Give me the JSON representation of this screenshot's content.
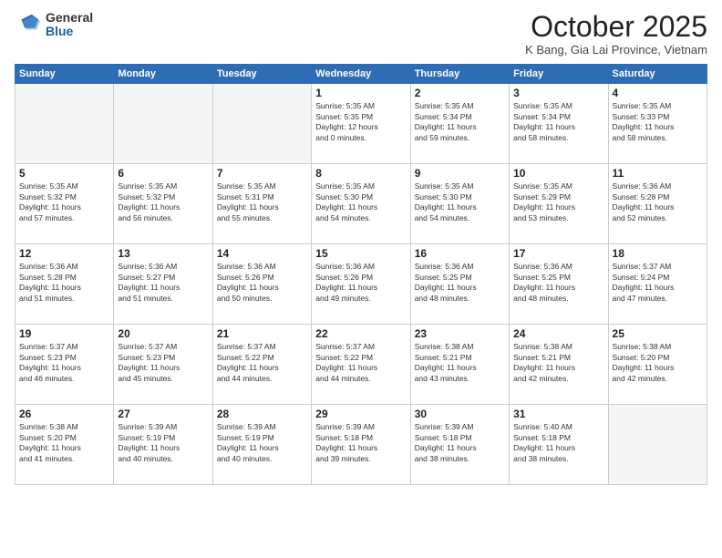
{
  "logo": {
    "general": "General",
    "blue": "Blue"
  },
  "header": {
    "month": "October 2025",
    "location": "K Bang, Gia Lai Province, Vietnam"
  },
  "weekdays": [
    "Sunday",
    "Monday",
    "Tuesday",
    "Wednesday",
    "Thursday",
    "Friday",
    "Saturday"
  ],
  "weeks": [
    [
      {
        "day": "",
        "info": ""
      },
      {
        "day": "",
        "info": ""
      },
      {
        "day": "",
        "info": ""
      },
      {
        "day": "1",
        "info": "Sunrise: 5:35 AM\nSunset: 5:35 PM\nDaylight: 12 hours\nand 0 minutes."
      },
      {
        "day": "2",
        "info": "Sunrise: 5:35 AM\nSunset: 5:34 PM\nDaylight: 11 hours\nand 59 minutes."
      },
      {
        "day": "3",
        "info": "Sunrise: 5:35 AM\nSunset: 5:34 PM\nDaylight: 11 hours\nand 58 minutes."
      },
      {
        "day": "4",
        "info": "Sunrise: 5:35 AM\nSunset: 5:33 PM\nDaylight: 11 hours\nand 58 minutes."
      }
    ],
    [
      {
        "day": "5",
        "info": "Sunrise: 5:35 AM\nSunset: 5:32 PM\nDaylight: 11 hours\nand 57 minutes."
      },
      {
        "day": "6",
        "info": "Sunrise: 5:35 AM\nSunset: 5:32 PM\nDaylight: 11 hours\nand 56 minutes."
      },
      {
        "day": "7",
        "info": "Sunrise: 5:35 AM\nSunset: 5:31 PM\nDaylight: 11 hours\nand 55 minutes."
      },
      {
        "day": "8",
        "info": "Sunrise: 5:35 AM\nSunset: 5:30 PM\nDaylight: 11 hours\nand 54 minutes."
      },
      {
        "day": "9",
        "info": "Sunrise: 5:35 AM\nSunset: 5:30 PM\nDaylight: 11 hours\nand 54 minutes."
      },
      {
        "day": "10",
        "info": "Sunrise: 5:35 AM\nSunset: 5:29 PM\nDaylight: 11 hours\nand 53 minutes."
      },
      {
        "day": "11",
        "info": "Sunrise: 5:36 AM\nSunset: 5:28 PM\nDaylight: 11 hours\nand 52 minutes."
      }
    ],
    [
      {
        "day": "12",
        "info": "Sunrise: 5:36 AM\nSunset: 5:28 PM\nDaylight: 11 hours\nand 51 minutes."
      },
      {
        "day": "13",
        "info": "Sunrise: 5:36 AM\nSunset: 5:27 PM\nDaylight: 11 hours\nand 51 minutes."
      },
      {
        "day": "14",
        "info": "Sunrise: 5:36 AM\nSunset: 5:26 PM\nDaylight: 11 hours\nand 50 minutes."
      },
      {
        "day": "15",
        "info": "Sunrise: 5:36 AM\nSunset: 5:26 PM\nDaylight: 11 hours\nand 49 minutes."
      },
      {
        "day": "16",
        "info": "Sunrise: 5:36 AM\nSunset: 5:25 PM\nDaylight: 11 hours\nand 48 minutes."
      },
      {
        "day": "17",
        "info": "Sunrise: 5:36 AM\nSunset: 5:25 PM\nDaylight: 11 hours\nand 48 minutes."
      },
      {
        "day": "18",
        "info": "Sunrise: 5:37 AM\nSunset: 5:24 PM\nDaylight: 11 hours\nand 47 minutes."
      }
    ],
    [
      {
        "day": "19",
        "info": "Sunrise: 5:37 AM\nSunset: 5:23 PM\nDaylight: 11 hours\nand 46 minutes."
      },
      {
        "day": "20",
        "info": "Sunrise: 5:37 AM\nSunset: 5:23 PM\nDaylight: 11 hours\nand 45 minutes."
      },
      {
        "day": "21",
        "info": "Sunrise: 5:37 AM\nSunset: 5:22 PM\nDaylight: 11 hours\nand 44 minutes."
      },
      {
        "day": "22",
        "info": "Sunrise: 5:37 AM\nSunset: 5:22 PM\nDaylight: 11 hours\nand 44 minutes."
      },
      {
        "day": "23",
        "info": "Sunrise: 5:38 AM\nSunset: 5:21 PM\nDaylight: 11 hours\nand 43 minutes."
      },
      {
        "day": "24",
        "info": "Sunrise: 5:38 AM\nSunset: 5:21 PM\nDaylight: 11 hours\nand 42 minutes."
      },
      {
        "day": "25",
        "info": "Sunrise: 5:38 AM\nSunset: 5:20 PM\nDaylight: 11 hours\nand 42 minutes."
      }
    ],
    [
      {
        "day": "26",
        "info": "Sunrise: 5:38 AM\nSunset: 5:20 PM\nDaylight: 11 hours\nand 41 minutes."
      },
      {
        "day": "27",
        "info": "Sunrise: 5:39 AM\nSunset: 5:19 PM\nDaylight: 11 hours\nand 40 minutes."
      },
      {
        "day": "28",
        "info": "Sunrise: 5:39 AM\nSunset: 5:19 PM\nDaylight: 11 hours\nand 40 minutes."
      },
      {
        "day": "29",
        "info": "Sunrise: 5:39 AM\nSunset: 5:18 PM\nDaylight: 11 hours\nand 39 minutes."
      },
      {
        "day": "30",
        "info": "Sunrise: 5:39 AM\nSunset: 5:18 PM\nDaylight: 11 hours\nand 38 minutes."
      },
      {
        "day": "31",
        "info": "Sunrise: 5:40 AM\nSunset: 5:18 PM\nDaylight: 11 hours\nand 38 minutes."
      },
      {
        "day": "",
        "info": ""
      }
    ]
  ]
}
